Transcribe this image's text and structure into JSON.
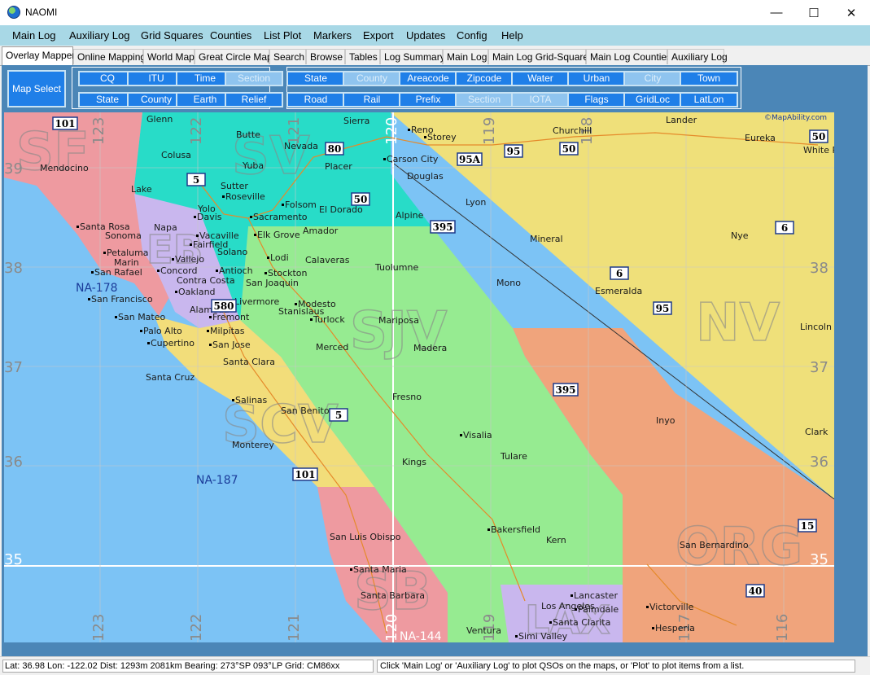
{
  "window": {
    "title": "NAOMI",
    "minimize": "—",
    "maximize": "☐",
    "close": "✕"
  },
  "menu": [
    "Main Log",
    "Auxiliary Log",
    "Grid Squares",
    "Counties",
    "List Plot",
    "Markers",
    "Export",
    "Updates",
    "Config",
    "Help"
  ],
  "tabs": [
    "Overlay Mapper",
    "Online Mapping",
    "World Map",
    "Great Circle Map",
    "Search",
    "Browse",
    "Tables",
    "Log Summary",
    "Main Log",
    "Main Log Grid-Squares",
    "Main Log Counties",
    "Auxiliary Log"
  ],
  "map_select": "Map Select",
  "overlay_buttons_a": [
    {
      "label": "CQ",
      "dim": false
    },
    {
      "label": "ITU",
      "dim": false
    },
    {
      "label": "Time",
      "dim": false
    },
    {
      "label": "Section",
      "dim": true
    },
    {
      "label": "State",
      "dim": false
    },
    {
      "label": "County",
      "dim": false
    },
    {
      "label": "Earth",
      "dim": false
    },
    {
      "label": "Relief",
      "dim": false
    }
  ],
  "overlay_buttons_b": [
    {
      "label": "State",
      "dim": false
    },
    {
      "label": "County",
      "dim": true
    },
    {
      "label": "Areacode",
      "dim": false
    },
    {
      "label": "Zipcode",
      "dim": false
    },
    {
      "label": "Water",
      "dim": false
    },
    {
      "label": "Urban",
      "dim": false
    },
    {
      "label": "City",
      "dim": true
    },
    {
      "label": "Town",
      "dim": false
    },
    {
      "label": "Road",
      "dim": false
    },
    {
      "label": "Rail",
      "dim": false
    },
    {
      "label": "Prefix",
      "dim": false
    },
    {
      "label": "Section",
      "dim": true
    },
    {
      "label": "IOTA",
      "dim": true
    },
    {
      "label": "Flags",
      "dim": false
    },
    {
      "label": "GridLoc",
      "dim": false
    },
    {
      "label": "LatLon",
      "dim": false
    }
  ],
  "map": {
    "credit": "©MapAbility.com",
    "colors": {
      "ocean": "#7cc3f5",
      "nv": "#efe07a",
      "sf": "#ee9aa0",
      "sv": "#28dcc8",
      "sjv": "#96eb91",
      "scv": "#f2dd7a",
      "org": "#f0a47c",
      "eb": "#c9b7ee",
      "sb": "#ee9aa0",
      "lax": "#c9b7ee"
    },
    "section_labels": [
      "SF",
      "SV",
      "EB",
      "SJV",
      "SCV",
      "NV",
      "ORG",
      "SB",
      "LAX"
    ],
    "iota_labels": [
      "NA-178",
      "NA-187",
      "NA-144"
    ],
    "lat_labels": [
      "39",
      "38",
      "37",
      "36",
      "35"
    ],
    "lon_labels": [
      "123",
      "122",
      "121",
      "120",
      "119",
      "118",
      "117",
      "116"
    ],
    "counties": [
      "Glenn",
      "Butte",
      "Sierra",
      "Colusa",
      "Nevada",
      "Yuba",
      "Placer",
      "Mendocino",
      "Lake",
      "Sutter",
      "Yolo",
      "El Dorado",
      "Alpine",
      "Sonoma",
      "Napa",
      "Solano",
      "Amador",
      "Marin",
      "Calaveras",
      "Tuolumne",
      "Contra Costa",
      "San Joaquin",
      "Alameda",
      "Stanislaus",
      "Mariposa",
      "Mono",
      "Merced",
      "Madera",
      "Santa Clara",
      "Santa Cruz",
      "San Benito",
      "Monterey",
      "Fresno",
      "Kings",
      "Tulare",
      "Inyo",
      "Esmeralda",
      "Mineral",
      "Nye",
      "Lyon",
      "Douglas",
      "Churchill",
      "Lander",
      "Eureka",
      "White Pine",
      "Lincoln",
      "Clark",
      "Kern",
      "San Luis Obispo",
      "Santa Barbara",
      "Ventura",
      "Los Angeles",
      "San Bernardino"
    ],
    "cities": [
      "Reno",
      "Carson City",
      "Storey",
      "Roseville",
      "Sacramento",
      "Folsom",
      "Elk Grove",
      "Davis",
      "Vacaville",
      "Fairfield",
      "Vallejo",
      "Concord",
      "Antioch",
      "Lodi",
      "Stockton",
      "Santa Rosa",
      "Petaluma",
      "San Rafael",
      "San Francisco",
      "Oakland",
      "Fremont",
      "Livermore",
      "San Mateo",
      "Palo Alto",
      "Cupertino",
      "Milpitas",
      "San Jose",
      "Modesto",
      "Turlock",
      "Salinas",
      "Visalia",
      "Bakersfield",
      "Santa Maria",
      "Lancaster",
      "Palmdale",
      "Santa Clarita",
      "Simi Valley",
      "Victorville",
      "Hesperia"
    ],
    "highways": [
      "101",
      "80",
      "50",
      "95",
      "95A",
      "5",
      "395",
      "6",
      "580",
      "40",
      "15"
    ]
  },
  "status": {
    "left": "Lat: 36.98   Lon: -122.02   Dist: 1293m 2081km   Bearing: 273°SP  093°LP   Grid: CM86xx",
    "right": "Click 'Main Log' or 'Auxiliary Log' to plot QSOs on the maps, or 'Plot' to plot items from a list."
  }
}
